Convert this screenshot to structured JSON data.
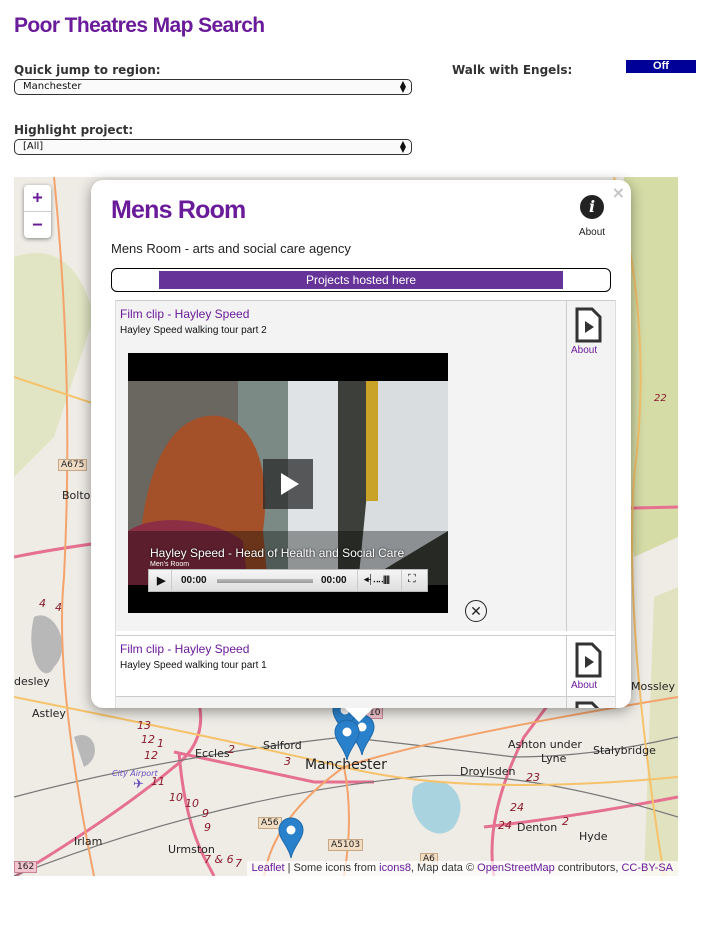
{
  "page": {
    "title": "Poor Theatres Map Search"
  },
  "controls": {
    "region_label": "Quick jump to region:",
    "region_value": "Manchester",
    "project_label": "Highlight project:",
    "project_value": "[All]",
    "engels_label": "Walk with Engels:",
    "engels_value": "Off"
  },
  "map": {
    "zoom_in": "+",
    "zoom_out": "−",
    "place_labels": [
      "Bolton",
      "A675",
      "desley",
      "Astley",
      "Salford",
      "Eccles",
      "Manchester",
      "Ashton under",
      "Lyne",
      "Droylsden",
      "Stalybridge",
      "Mossley",
      "Denton",
      "Hyde",
      "Irlam",
      "Urmston",
      "City Airport",
      "A56",
      "A5103",
      "A6",
      "162",
      "22",
      "13",
      "12",
      "1",
      "12",
      "11",
      "10",
      "10",
      "9",
      "9",
      "2",
      "3",
      "4",
      "4",
      "23",
      "24",
      "24",
      "2",
      "7 & 6",
      "7",
      "10"
    ],
    "attribution": {
      "leaflet": "Leaflet",
      "sep1": " | Some icons from ",
      "icons8": "icons8",
      "sep2": ", Map data © ",
      "osm": "OpenStreetMap",
      "sep3": " contributors, ",
      "license": "CC-BY-SA"
    }
  },
  "popup": {
    "close": "×",
    "name": "Mens Room",
    "description": "Mens Room - arts and social care agency",
    "about_label": "About",
    "about_icon": "info-icon",
    "projects_header": "Projects hosted here",
    "items": [
      {
        "title": "Film clip - Hayley Speed",
        "description": "Hayley Speed walking tour part 2",
        "about": "About",
        "icon": "video-file-icon",
        "video": {
          "caption": "Hayley Speed - Head of Health and Social Care",
          "subcaption": "Men's Room",
          "current_time": "00:00",
          "duration": "00:00",
          "progress": 0
        }
      },
      {
        "title": "Film clip - Hayley Speed",
        "description": "Hayley Speed walking tour part 1",
        "about": "About",
        "icon": "video-file-icon"
      }
    ]
  },
  "colors": {
    "brand_purple": "#6a1b9a",
    "header_bar": "#663399",
    "toggle_bg": "#000099",
    "marker_blue": "#2a81cb"
  }
}
